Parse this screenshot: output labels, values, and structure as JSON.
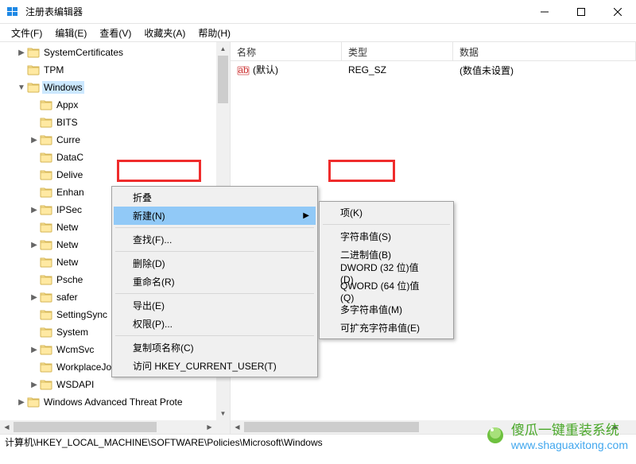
{
  "window": {
    "title": "注册表编辑器"
  },
  "menubar": [
    {
      "label": "文件(F)"
    },
    {
      "label": "编辑(E)"
    },
    {
      "label": "查看(V)"
    },
    {
      "label": "收藏夹(A)"
    },
    {
      "label": "帮助(H)"
    }
  ],
  "tree": [
    {
      "label": "SystemCertificates",
      "indent": 1,
      "exp": "▶"
    },
    {
      "label": "TPM",
      "indent": 1,
      "exp": ""
    },
    {
      "label": "Windows",
      "indent": 1,
      "exp": "▼",
      "selected": true
    },
    {
      "label": "Appx",
      "indent": 2,
      "exp": ""
    },
    {
      "label": "BITS",
      "indent": 2,
      "exp": ""
    },
    {
      "label": "Curre",
      "indent": 2,
      "exp": "▶"
    },
    {
      "label": "DataC",
      "indent": 2,
      "exp": ""
    },
    {
      "label": "Delive",
      "indent": 2,
      "exp": ""
    },
    {
      "label": "Enhan",
      "indent": 2,
      "exp": ""
    },
    {
      "label": "IPSec",
      "indent": 2,
      "exp": "▶"
    },
    {
      "label": "Netw",
      "indent": 2,
      "exp": ""
    },
    {
      "label": "Netw",
      "indent": 2,
      "exp": "▶"
    },
    {
      "label": "Netw",
      "indent": 2,
      "exp": ""
    },
    {
      "label": "Psche",
      "indent": 2,
      "exp": ""
    },
    {
      "label": "safer",
      "indent": 2,
      "exp": "▶"
    },
    {
      "label": "SettingSync",
      "indent": 2,
      "exp": ""
    },
    {
      "label": "System",
      "indent": 2,
      "exp": ""
    },
    {
      "label": "WcmSvc",
      "indent": 2,
      "exp": "▶"
    },
    {
      "label": "WorkplaceJoin",
      "indent": 2,
      "exp": ""
    },
    {
      "label": "WSDAPI",
      "indent": 2,
      "exp": "▶"
    },
    {
      "label": "Windows Advanced Threat Prote",
      "indent": 1,
      "exp": "▶"
    }
  ],
  "list": {
    "cols": {
      "name": "名称",
      "type": "类型",
      "data": "数据"
    },
    "rows": [
      {
        "name": "(默认)",
        "type": "REG_SZ",
        "data": "(数值未设置)"
      }
    ]
  },
  "ctx1": [
    {
      "label": "折叠",
      "kind": "item"
    },
    {
      "label": "新建(N)",
      "kind": "item",
      "arrow": true,
      "hovered": true
    },
    {
      "kind": "sep"
    },
    {
      "label": "查找(F)...",
      "kind": "item"
    },
    {
      "kind": "sep"
    },
    {
      "label": "删除(D)",
      "kind": "item"
    },
    {
      "label": "重命名(R)",
      "kind": "item"
    },
    {
      "kind": "sep"
    },
    {
      "label": "导出(E)",
      "kind": "item"
    },
    {
      "label": "权限(P)...",
      "kind": "item"
    },
    {
      "kind": "sep"
    },
    {
      "label": "复制项名称(C)",
      "kind": "item"
    },
    {
      "label": "访问 HKEY_CURRENT_USER(T)",
      "kind": "item"
    }
  ],
  "ctx2": [
    {
      "label": "项(K)",
      "kind": "item"
    },
    {
      "kind": "sep"
    },
    {
      "label": "字符串值(S)",
      "kind": "item"
    },
    {
      "label": "二进制值(B)",
      "kind": "item"
    },
    {
      "label": "DWORD (32 位)值(D)",
      "kind": "item"
    },
    {
      "label": "QWORD (64 位)值(Q)",
      "kind": "item"
    },
    {
      "label": "多字符串值(M)",
      "kind": "item"
    },
    {
      "label": "可扩充字符串值(E)",
      "kind": "item"
    }
  ],
  "statusbar": "计算机\\HKEY_LOCAL_MACHINE\\SOFTWARE\\Policies\\Microsoft\\Windows",
  "watermark": {
    "line1": "傻瓜一键重装系统",
    "line2": "www.shaguaxitong.com"
  }
}
